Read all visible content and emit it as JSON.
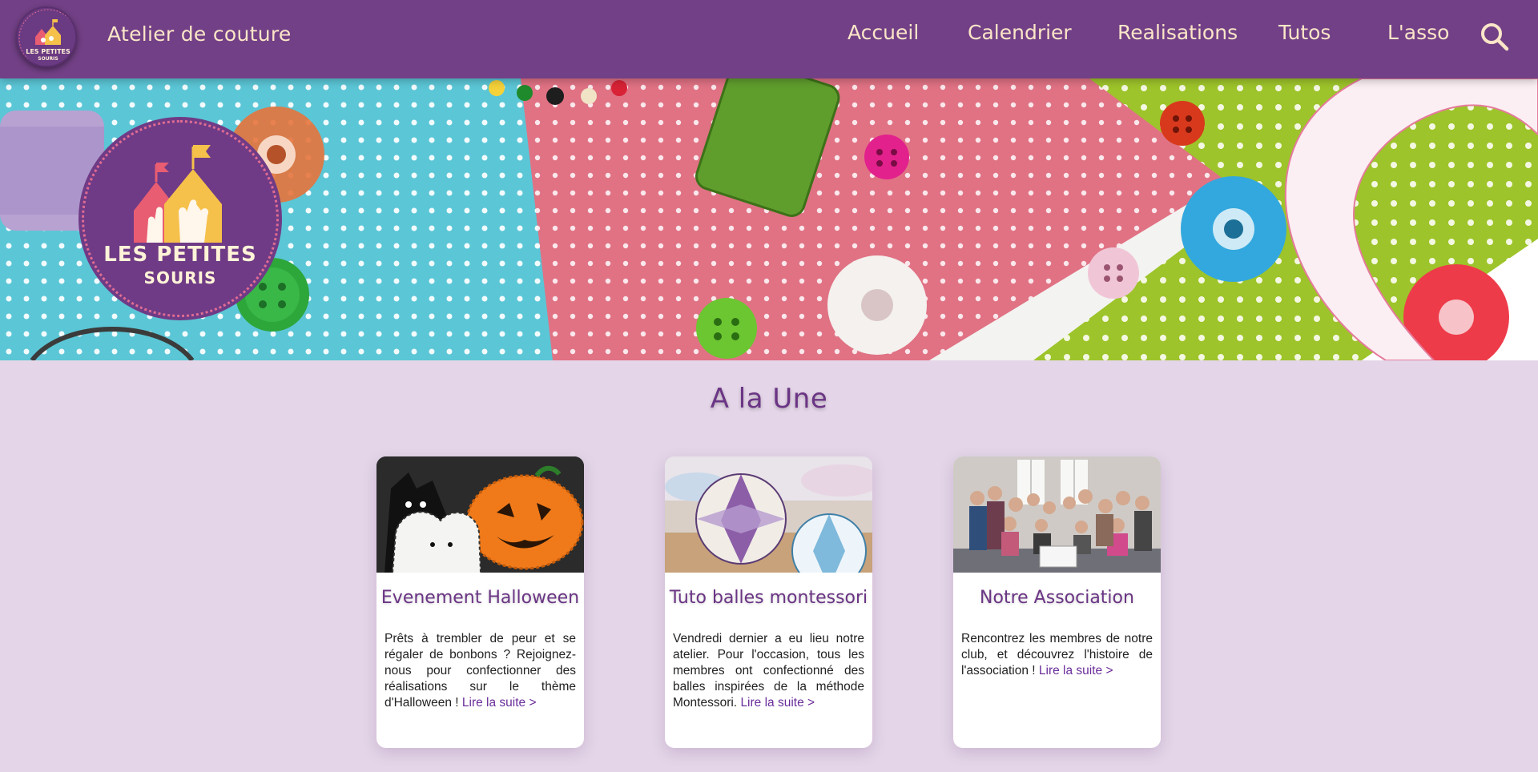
{
  "header": {
    "logo_text_line1": "LES PETITES",
    "logo_text_line2": "SOURIS",
    "site_title": "Atelier de couture",
    "nav": [
      {
        "label": "Accueil"
      },
      {
        "label": "Calendrier"
      },
      {
        "label": "Realisations"
      },
      {
        "label": "Tutos"
      },
      {
        "label": "L'asso"
      }
    ],
    "search_icon": "search-icon"
  },
  "hero": {
    "logo_text_line1": "LES PETITES",
    "logo_text_line2": "SOURIS"
  },
  "section": {
    "title": "A la Une"
  },
  "cards": [
    {
      "title": "Evenement Halloween",
      "text": "Prêts à trembler de peur et se régaler de bonbons ? Rejoignez-nous pour confectionner des réalisations sur le thème d'Halloween !",
      "more": "Lire la suite >"
    },
    {
      "title": "Tuto balles montessori",
      "text": "Vendredi dernier a eu lieu notre atelier. Pour l'occasion, tous les membres ont confectionné des balles inspirées de la méthode Montessori.",
      "more": "Lire la suite >"
    },
    {
      "title": "Notre Association",
      "text": "Rencontrez les membres de notre club, et découvrez l'histoire de l'association !",
      "more": "Lire la suite >"
    }
  ],
  "colors": {
    "header_bg": "#724086",
    "page_bg": "#e4d6e8",
    "accent_text": "#6b3585",
    "nav_text": "#fbe6c8",
    "link": "#6a2d9a"
  }
}
